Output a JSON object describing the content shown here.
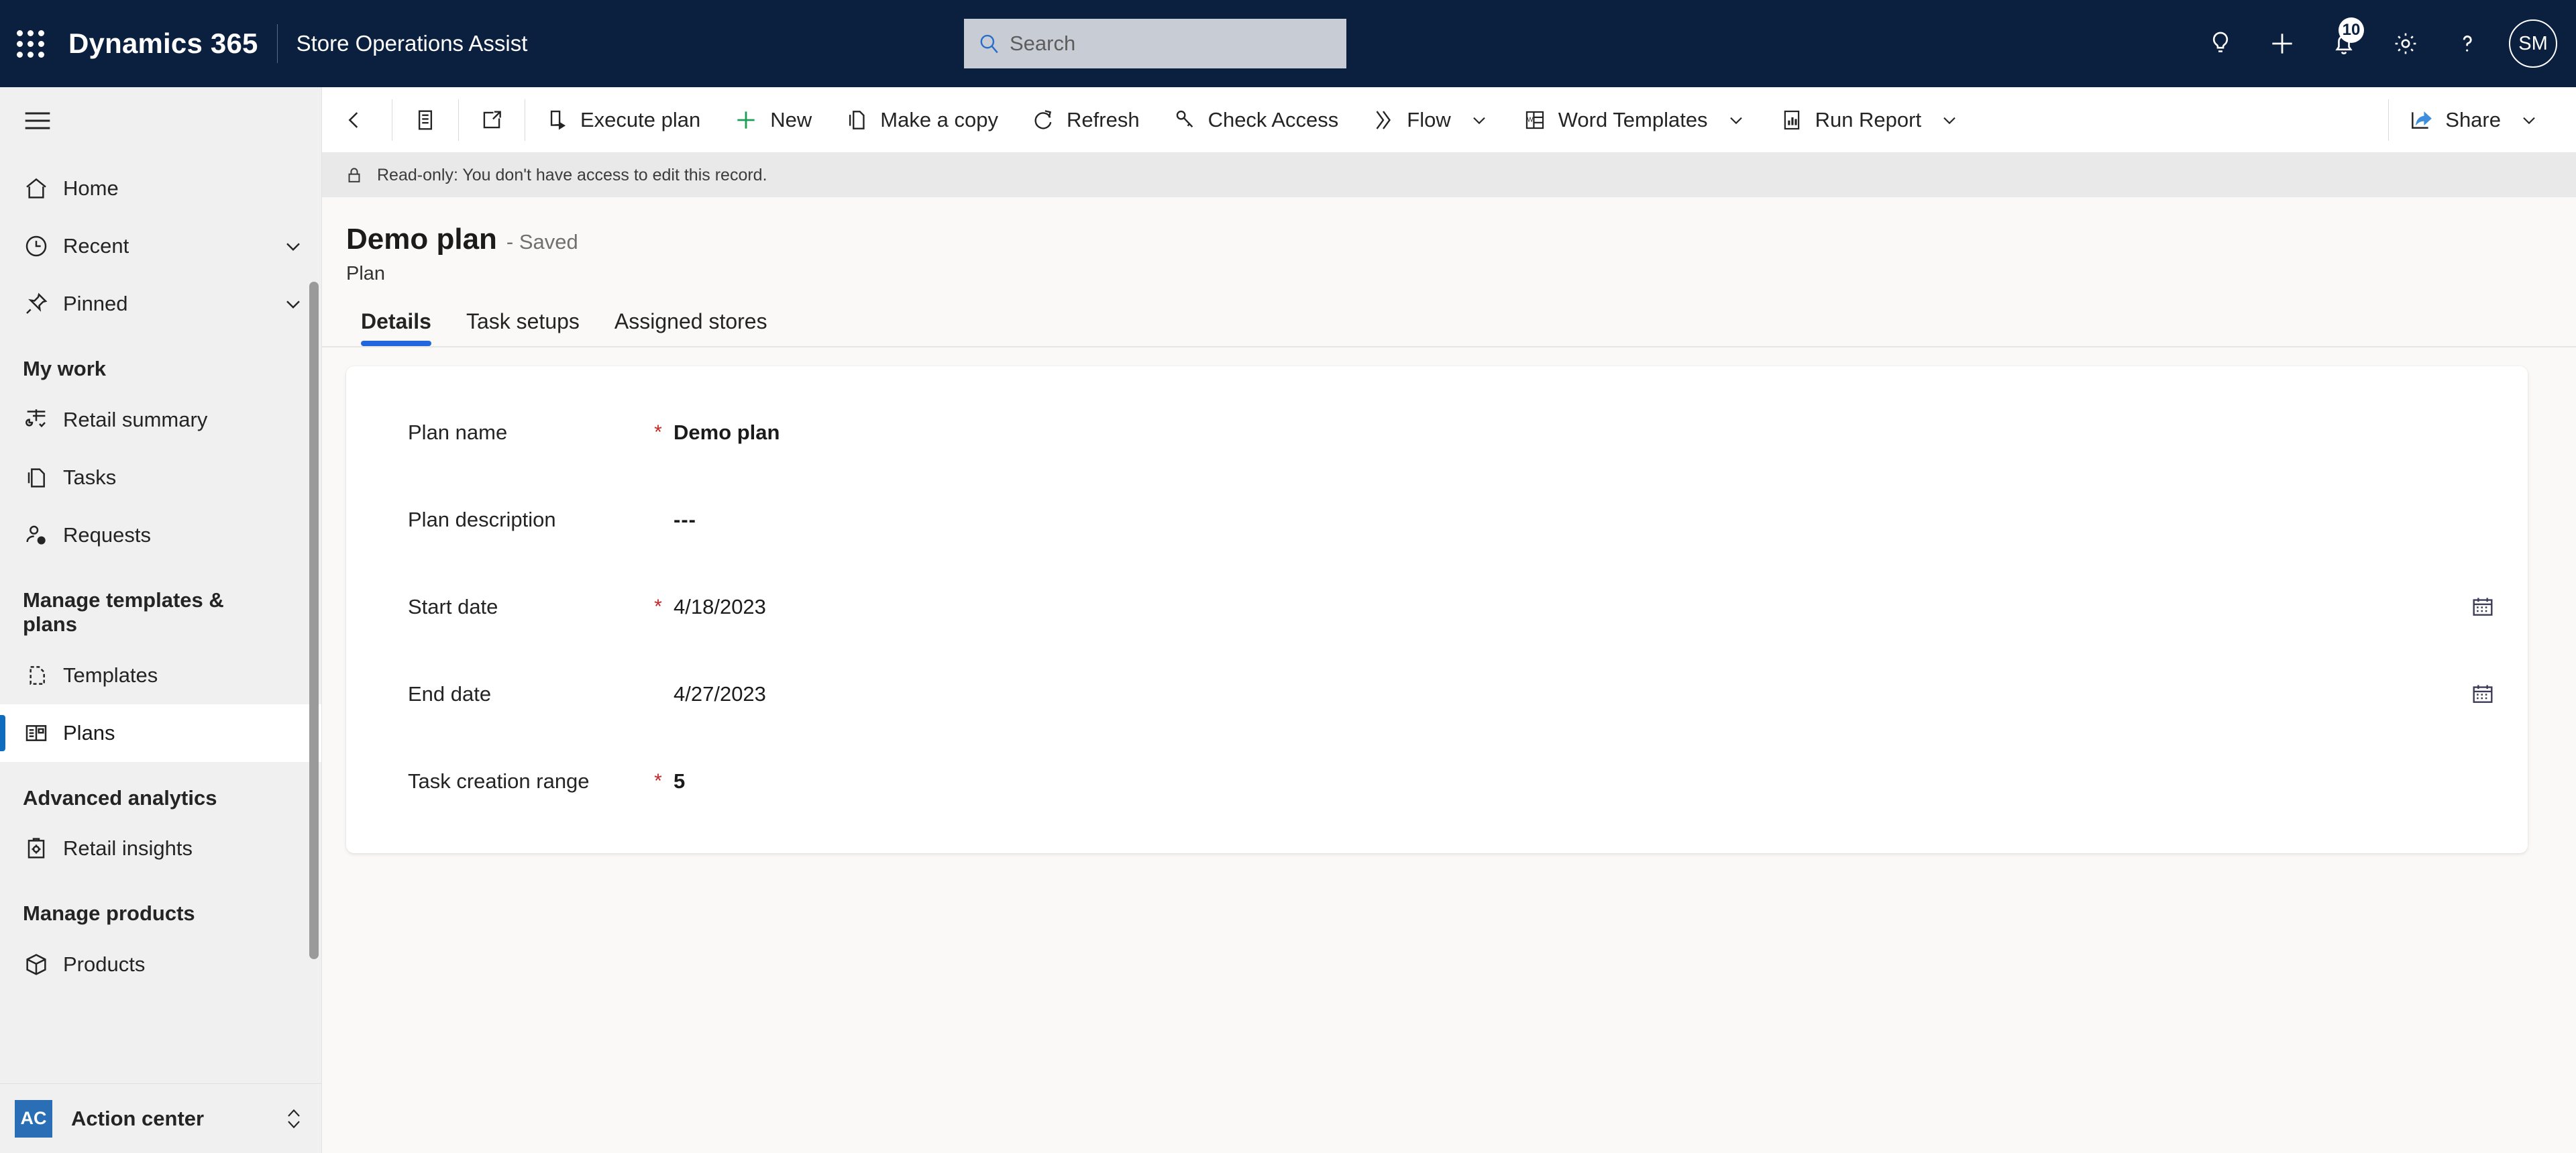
{
  "header": {
    "waffle_label": "app-launcher",
    "brand": "Dynamics 365",
    "app_name": "Store Operations Assist",
    "search_placeholder": "Search",
    "notifications_count": "10",
    "avatar_initials": "SM"
  },
  "sidebar": {
    "top": [
      {
        "label": "Home",
        "icon": "home-icon",
        "chevron": false
      },
      {
        "label": "Recent",
        "icon": "clock-icon",
        "chevron": true
      },
      {
        "label": "Pinned",
        "icon": "pin-icon",
        "chevron": true
      }
    ],
    "groups": [
      {
        "title": "My work",
        "items": [
          {
            "label": "Retail summary",
            "icon": "chart-insights-icon"
          },
          {
            "label": "Tasks",
            "icon": "documents-icon"
          },
          {
            "label": "Requests",
            "icon": "person-question-icon"
          }
        ]
      },
      {
        "title": "Manage templates & plans",
        "items": [
          {
            "label": "Templates",
            "icon": "template-page-icon"
          },
          {
            "label": "Plans",
            "icon": "plans-grid-icon",
            "selected": true
          }
        ]
      },
      {
        "title": "Advanced analytics",
        "items": [
          {
            "label": "Retail insights",
            "icon": "clipboard-gear-icon"
          }
        ]
      },
      {
        "title": "Manage products",
        "items": [
          {
            "label": "Products",
            "icon": "box-icon"
          }
        ]
      }
    ],
    "action_center": {
      "badge": "AC",
      "label": "Action center",
      "chevron_icon": "up-down-chevron-icon"
    }
  },
  "commandbar": {
    "back_icon": "back-arrow-icon",
    "form_icon": "form-list-icon",
    "popout_icon": "open-in-new-window-icon",
    "buttons": [
      {
        "label": "Execute plan",
        "icon": "execute-plan-icon",
        "chevron": false
      },
      {
        "label": "New",
        "icon": "plus-icon",
        "chevron": false
      },
      {
        "label": "Make a copy",
        "icon": "copy-icon",
        "chevron": false
      },
      {
        "label": "Refresh",
        "icon": "refresh-icon",
        "chevron": false
      },
      {
        "label": "Check Access",
        "icon": "key-icon",
        "chevron": false
      },
      {
        "label": "Flow",
        "icon": "flow-icon",
        "chevron": true
      },
      {
        "label": "Word Templates",
        "icon": "word-icon",
        "chevron": true
      },
      {
        "label": "Run Report",
        "icon": "report-icon",
        "chevron": true
      }
    ],
    "share": {
      "label": "Share",
      "icon": "share-icon",
      "chevron": true
    }
  },
  "notification": {
    "icon": "lock-icon",
    "text": "Read-only: You don't have access to edit this record."
  },
  "record": {
    "title": "Demo plan",
    "saved_status": "- Saved",
    "entity": "Plan"
  },
  "tabs": [
    {
      "label": "Details",
      "active": true
    },
    {
      "label": "Task setups",
      "active": false
    },
    {
      "label": "Assigned stores",
      "active": false
    }
  ],
  "form": {
    "fields": [
      {
        "label": "Plan name",
        "required": true,
        "value": "Demo plan",
        "calendar": false
      },
      {
        "label": "Plan description",
        "required": false,
        "value": "---",
        "calendar": false
      },
      {
        "label": "Start date",
        "required": true,
        "value": "4/18/2023",
        "calendar": true
      },
      {
        "label": "End date",
        "required": false,
        "value": "4/27/2023",
        "calendar": true
      },
      {
        "label": "Task creation range",
        "required": true,
        "value": "5",
        "calendar": false
      }
    ]
  },
  "colors": {
    "header_bg": "#0b1f3f",
    "accent_blue": "#2266dd",
    "selected_indicator": "#0f6cbd",
    "required_red": "#c62828",
    "new_green": "#1f9d55",
    "action_badge": "#2a6fb5"
  }
}
